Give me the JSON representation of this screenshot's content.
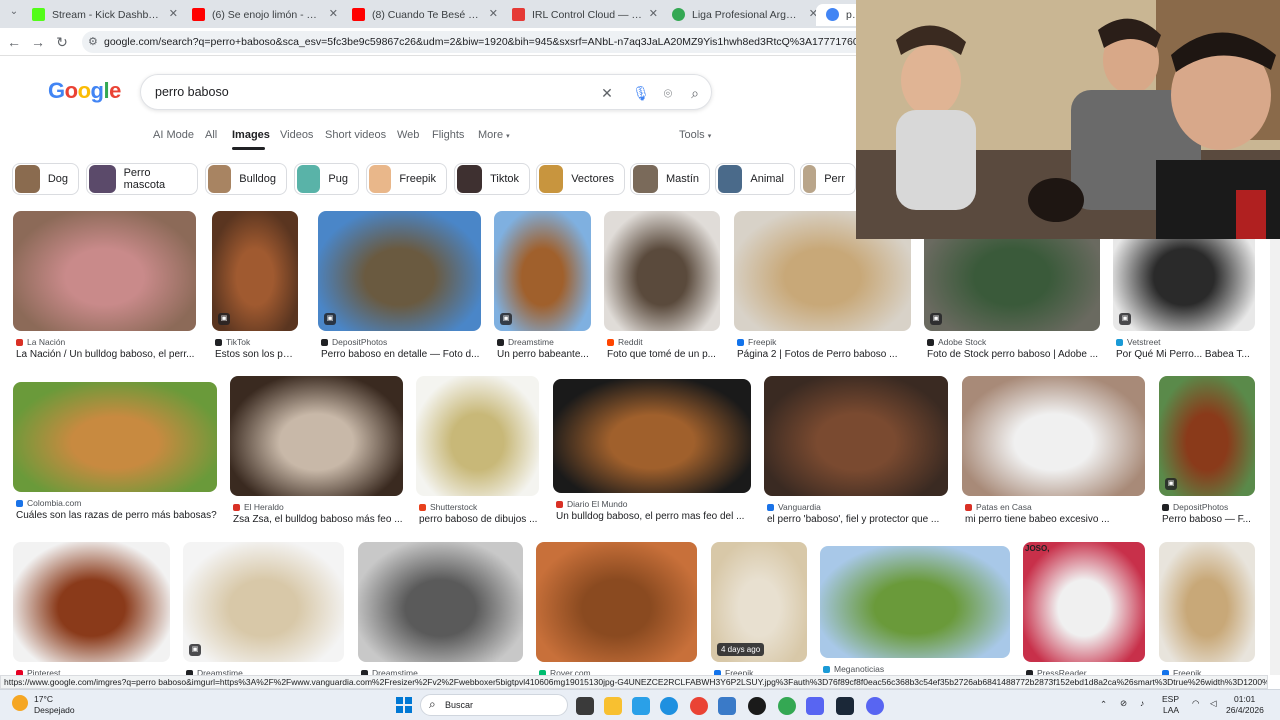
{
  "browser": {
    "tabs": [
      {
        "label": "Stream - Kick Dashboard",
        "color": "#53fc18"
      },
      {
        "label": "(6) Se enojo limón - YouTube",
        "color": "#ff0000"
      },
      {
        "label": "(8) Cuando Te Besé - Becky G, N",
        "color": "#ff0000"
      },
      {
        "label": "IRL Control Cloud — Panel de",
        "color": "#e53935"
      },
      {
        "label": "Liga Profesional Argentina - PC",
        "color": "#34a853"
      },
      {
        "label": "perro",
        "color": "#4285f4"
      }
    ],
    "url": "google.com/search?q=perro+baboso&sca_esv=5fc3be9c59867c26&udm=2&biw=1920&bih=945&sxsrf=ANbL-n7aq3JaLA20MZ9Yis1hwh8ed3RtcQ%3A1777176032064&ei=4I3taZvTA"
  },
  "google": {
    "logo": "Google",
    "query": "perro baboso",
    "filters": [
      "AI Mode",
      "All",
      "Images",
      "Videos",
      "Short videos",
      "Web",
      "Flights",
      "More"
    ],
    "tools": "Tools",
    "chips": [
      {
        "label": "Dog",
        "color": "#8a6b4f"
      },
      {
        "label": "Perro mascota",
        "color": "#5b4a6a"
      },
      {
        "label": "Bulldog",
        "color": "#a88462"
      },
      {
        "label": "Pug",
        "color": "#59b3a8"
      },
      {
        "label": "Freepik",
        "color": "#e9b78a"
      },
      {
        "label": "Tiktok",
        "color": "#3e3030"
      },
      {
        "label": "Vectores",
        "color": "#c8953e"
      },
      {
        "label": "Mastín",
        "color": "#7a6a5a"
      },
      {
        "label": "Animal",
        "color": "#4a6a8a"
      },
      {
        "label": "Perr",
        "color": "#b9a58a"
      }
    ],
    "results": [
      {
        "source": "La Nación",
        "caption": "La Nación / Un bulldog baboso, el perr...",
        "c1": "#8c6a58",
        "c2": "#c98a8a",
        "sc": "#d93025"
      },
      {
        "source": "TikTok",
        "caption": "Estos son los perr...",
        "c1": "#5a3520",
        "c2": "#a05a30",
        "sc": "#202124"
      },
      {
        "source": "DepositPhotos",
        "caption": "Perro baboso en detalle — Foto d...",
        "c1": "#4a86c8",
        "c2": "#6a5a40",
        "sc": "#202124"
      },
      {
        "source": "Dreamstime",
        "caption": "Un perro babeante...",
        "c1": "#7fb0e0",
        "c2": "#a0602c",
        "sc": "#202124"
      },
      {
        "source": "Reddit",
        "caption": "Foto que tomé de un p...",
        "c1": "#e0dcd8",
        "c2": "#5a4a3c",
        "sc": "#ff4500"
      },
      {
        "source": "Freepik",
        "caption": "Página 2 | Fotos de Perro baboso ...",
        "c1": "#d8d2c8",
        "c2": "#c8a878",
        "sc": "#1273eb"
      },
      {
        "source": "Adobe Stock",
        "caption": "Foto de Stock perro baboso | Adobe ...",
        "c1": "#6a6a60",
        "c2": "#3a5a3a",
        "sc": "#202124"
      },
      {
        "source": "Vetstreet",
        "caption": "Por Qué Mi Perro... Babea T...",
        "c1": "#e8e8e8",
        "c2": "#2a2a2a",
        "sc": "#1a9ad6"
      },
      {
        "source": "Colombia.com",
        "caption": "Cuáles son las razas de perro más babosas?",
        "c1": "#6a9a3a",
        "c2": "#c88a40",
        "sc": "#1a73e8"
      },
      {
        "source": "El Heraldo",
        "caption": "Zsa Zsa, el bulldog baboso más feo ...",
        "c1": "#3a2a20",
        "c2": "#c8b8a8",
        "sc": "#d93025"
      },
      {
        "source": "Shutterstock",
        "caption": "perro baboso de dibujos ...",
        "c1": "#f4f4f0",
        "c2": "#c8b878",
        "sc": "#e8401c"
      },
      {
        "source": "Diario El Mundo",
        "caption": "Un bulldog baboso, el perro mas feo del ...",
        "c1": "#1a1a1a",
        "c2": "#a0602c",
        "sc": "#d93025"
      },
      {
        "source": "Vanguardia",
        "caption": "el perro 'baboso', fiel y protector que ...",
        "c1": "#3a2a22",
        "c2": "#7a4a30",
        "sc": "#1a73e8"
      },
      {
        "source": "Patas en Casa",
        "caption": "mi perro tiene babeo excesivo ...",
        "c1": "#a88a78",
        "c2": "#f0f0f0",
        "sc": "#d93025"
      },
      {
        "source": "DepositPhotos",
        "caption": "Perro baboso — F...",
        "c1": "#5a8a4a",
        "c2": "#8a3a1a",
        "sc": "#202124"
      },
      {
        "source": "Pinterest",
        "caption": "",
        "c1": "#f2f2f2",
        "c2": "#8a3a1a",
        "sc": "#e60023"
      },
      {
        "source": "Dreamstime",
        "caption": "",
        "c1": "#f4f4f4",
        "c2": "#d8c8a8",
        "sc": "#202124"
      },
      {
        "source": "Dreamstime",
        "caption": "",
        "c1": "#c8c8c8",
        "c2": "#5a5a5a",
        "sc": "#202124"
      },
      {
        "source": "Rover.com",
        "caption": "",
        "c1": "#c8703a",
        "c2": "#8a4a20",
        "sc": "#00bd70"
      },
      {
        "source": "Freepik",
        "caption": "",
        "c1": "#d8c8a8",
        "c2": "#e8e0d0",
        "sc": "#1273eb"
      },
      {
        "source": "Meganoticias",
        "caption": "",
        "c1": "#a8c8e8",
        "c2": "#6a9a3a",
        "sc": "#1a9ad6"
      },
      {
        "source": "PressReader",
        "caption": "",
        "c1": "#c8304a",
        "c2": "#f0f0f0",
        "sc": "#202124"
      },
      {
        "source": "Freepik",
        "caption": "",
        "c1": "#e8e4dc",
        "c2": "#c8a878",
        "sc": "#1273eb"
      }
    ],
    "badge_4days": "4 days ago",
    "watermark_text": "JOSO,"
  },
  "status_url": "https://www.google.com/imgres?q=perro baboso&imgurl=https%3A%2F%2Fwww.vanguardia.com%2Fresizer%2Fv2%2Fwebboxer5bigtpvl410606mg19015130jpg-G4UNEZCE2RCLFABWH3Y6P2LSUY.jpg%3Fauth%3D76f89cf8f0eac56c368b3c54ef35b2726ab6841488772b2873f152ebd1d8a2ca%26smart%3Dtrue%26width%3D1200%26height%3D800%26q...",
  "taskbar": {
    "temp": "17°C",
    "weather": "Despejado",
    "search_placeholder": "Buscar",
    "lang1": "ESP",
    "lang2": "LAA",
    "time": "01:01",
    "date": "26/4/2026"
  }
}
